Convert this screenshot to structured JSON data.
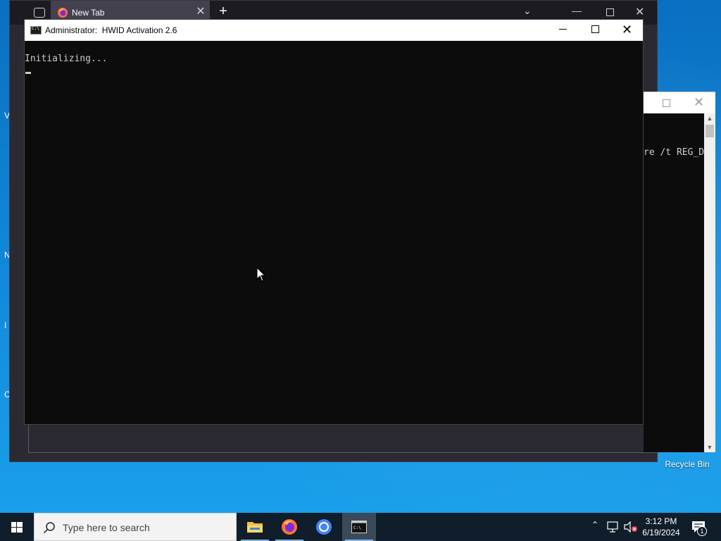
{
  "browser": {
    "tab_title": "New Tab",
    "new_tab_label": "+",
    "close_glyph": "✕"
  },
  "console": {
    "title_prefix": "Administrator:",
    "title_name": "HWID Activation 2.6",
    "lines": [
      "Initializing..."
    ]
  },
  "console2": {
    "visible_text": "re /t REG_D"
  },
  "desktop": {
    "recycle_bin_label": "Recycle Bin",
    "edge_letters": [
      "V",
      "N",
      "I",
      "C"
    ]
  },
  "taskbar": {
    "search_placeholder": "Type here to search",
    "apps": [
      {
        "name": "File Explorer",
        "icon": "folder-icon"
      },
      {
        "name": "Firefox",
        "icon": "firefox-icon"
      },
      {
        "name": "Chrome",
        "icon": "chrome-icon"
      },
      {
        "name": "Command Prompt",
        "icon": "terminal-icon",
        "active": true
      }
    ],
    "time": "3:12 PM",
    "date": "6/19/2024",
    "notification_count": "1"
  },
  "colors": {
    "console_bg": "#0c0c0c",
    "console_text": "#cccccc",
    "taskbar_bg": "#101d2a",
    "desktop_bg": "#0f86d6"
  }
}
